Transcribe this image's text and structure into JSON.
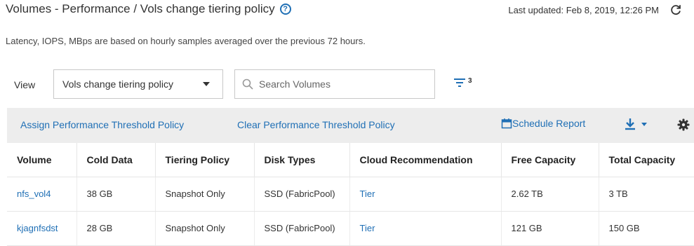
{
  "header": {
    "title": "Volumes - Performance / Vols change tiering policy",
    "last_updated": "Last updated: Feb 8, 2019, 12:26 PM"
  },
  "subtitle": "Latency, IOPS, MBps are based on hourly samples averaged over the previous 72 hours.",
  "controls": {
    "view_label": "View",
    "view_selected": "Vols change tiering policy",
    "search_placeholder": "Search Volumes",
    "filter_count": "3"
  },
  "toolbar": {
    "assign_label": "Assign Performance Threshold Policy",
    "clear_label": "Clear Performance Threshold Policy",
    "schedule_label": "Schedule Report"
  },
  "table": {
    "columns": [
      "Volume",
      "Cold Data",
      "Tiering Policy",
      "Disk Types",
      "Cloud Recommendation",
      "Free Capacity",
      "Total Capacity"
    ],
    "rows": [
      [
        "nfs_vol4",
        "38 GB",
        "Snapshot Only",
        "SSD (FabricPool)",
        "Tier",
        "2.62 TB",
        "3 TB"
      ],
      [
        "kjagnfsdst",
        "28 GB",
        "Snapshot Only",
        "SSD (FabricPool)",
        "Tier",
        "121 GB",
        "150 GB"
      ]
    ]
  },
  "colors": {
    "link": "#1f6fb5",
    "toolbar_bg": "#ededed"
  }
}
